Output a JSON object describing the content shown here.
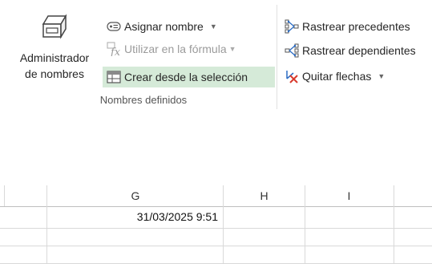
{
  "ribbon": {
    "name_manager": {
      "line1": "Administrador",
      "line2": "de nombres"
    },
    "define_name": "Asignar nombre",
    "use_in_formula": "Utilizar en la fórmula",
    "create_from_selection": "Crear desde la selección",
    "defined_names_group": "Nombres definidos",
    "trace_precedents": "Rastrear precedentes",
    "trace_dependents": "Rastrear dependientes",
    "remove_arrows": "Quitar flechas"
  },
  "sheet": {
    "columns": [
      "G",
      "H",
      "I"
    ],
    "cells": {
      "G1": "31/03/2025 9:51"
    }
  }
}
